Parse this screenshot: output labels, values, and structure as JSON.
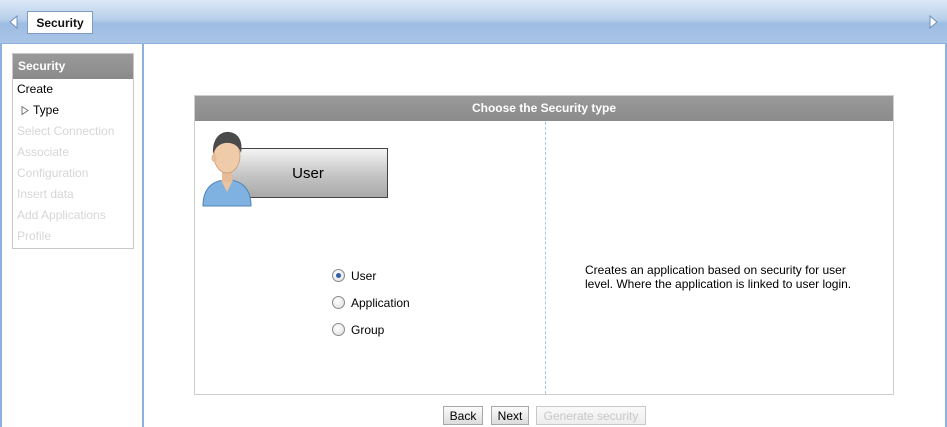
{
  "header": {
    "title": "Security",
    "back_icon": "chevron-left-icon",
    "forward_icon": "chevron-right-icon"
  },
  "sidebar": {
    "title": "Security",
    "items": [
      {
        "label": "Create",
        "state": "active"
      },
      {
        "label": "Type",
        "state": "current"
      },
      {
        "label": "Select Connection",
        "state": "disabled"
      },
      {
        "label": "Associate",
        "state": "disabled"
      },
      {
        "label": "Configuration",
        "state": "disabled"
      },
      {
        "label": "Insert data",
        "state": "disabled"
      },
      {
        "label": "Add Applications",
        "state": "disabled"
      },
      {
        "label": "Profile",
        "state": "disabled"
      }
    ]
  },
  "panel": {
    "title": "Choose the Security type",
    "type_box_label": "User",
    "options": [
      {
        "label": "User",
        "checked": true
      },
      {
        "label": "Application",
        "checked": false
      },
      {
        "label": "Group",
        "checked": false
      }
    ],
    "description": "Creates an application based on security for user level. Where the application is linked to user login."
  },
  "buttons": {
    "back": "Back",
    "next": "Next",
    "generate": "Generate security"
  },
  "colors": {
    "header_bg": "#b8cfea",
    "frame_border": "#8fb2dc",
    "panel_header": "#8b8b8b",
    "radio_checked": "#2f5fa8"
  }
}
